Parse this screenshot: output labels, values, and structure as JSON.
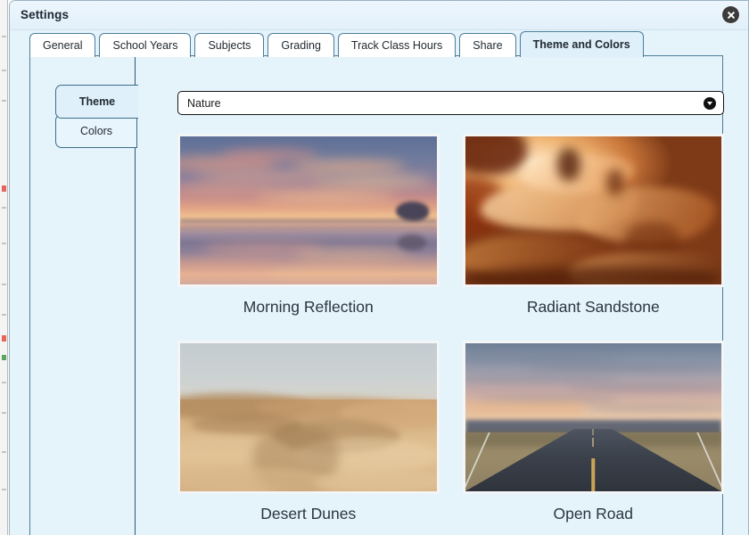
{
  "window": {
    "title": "Settings",
    "close_icon": "close-circle-icon"
  },
  "tabs": [
    {
      "label": "General",
      "active": false
    },
    {
      "label": "School Years",
      "active": false
    },
    {
      "label": "Subjects",
      "active": false
    },
    {
      "label": "Grading",
      "active": false
    },
    {
      "label": "Track Class Hours",
      "active": false
    },
    {
      "label": "Share",
      "active": false
    },
    {
      "label": "Theme and Colors",
      "active": true
    }
  ],
  "vertical_tabs": [
    {
      "label": "Theme",
      "active": true
    },
    {
      "label": "Colors",
      "active": false
    }
  ],
  "theme_select": {
    "value": "Nature",
    "arrow_icon": "chevron-down-circle-icon"
  },
  "themes": [
    {
      "label": "Morning Reflection",
      "art": "morning-reflection"
    },
    {
      "label": "Radiant Sandstone",
      "art": "radiant-sandstone"
    },
    {
      "label": "Desert Dunes",
      "art": "desert-dunes"
    },
    {
      "label": "Open Road",
      "art": "open-road"
    }
  ],
  "colors": {
    "dialog_background": "#e5f3fb",
    "titlebar_background": "#edf6fc",
    "panel_border": "#4d7d99",
    "active_tab_background": "#dff0fb",
    "text": "#222a31",
    "label_text": "#2c3540",
    "select_border": "#161616",
    "select_background": "#ffffff"
  }
}
